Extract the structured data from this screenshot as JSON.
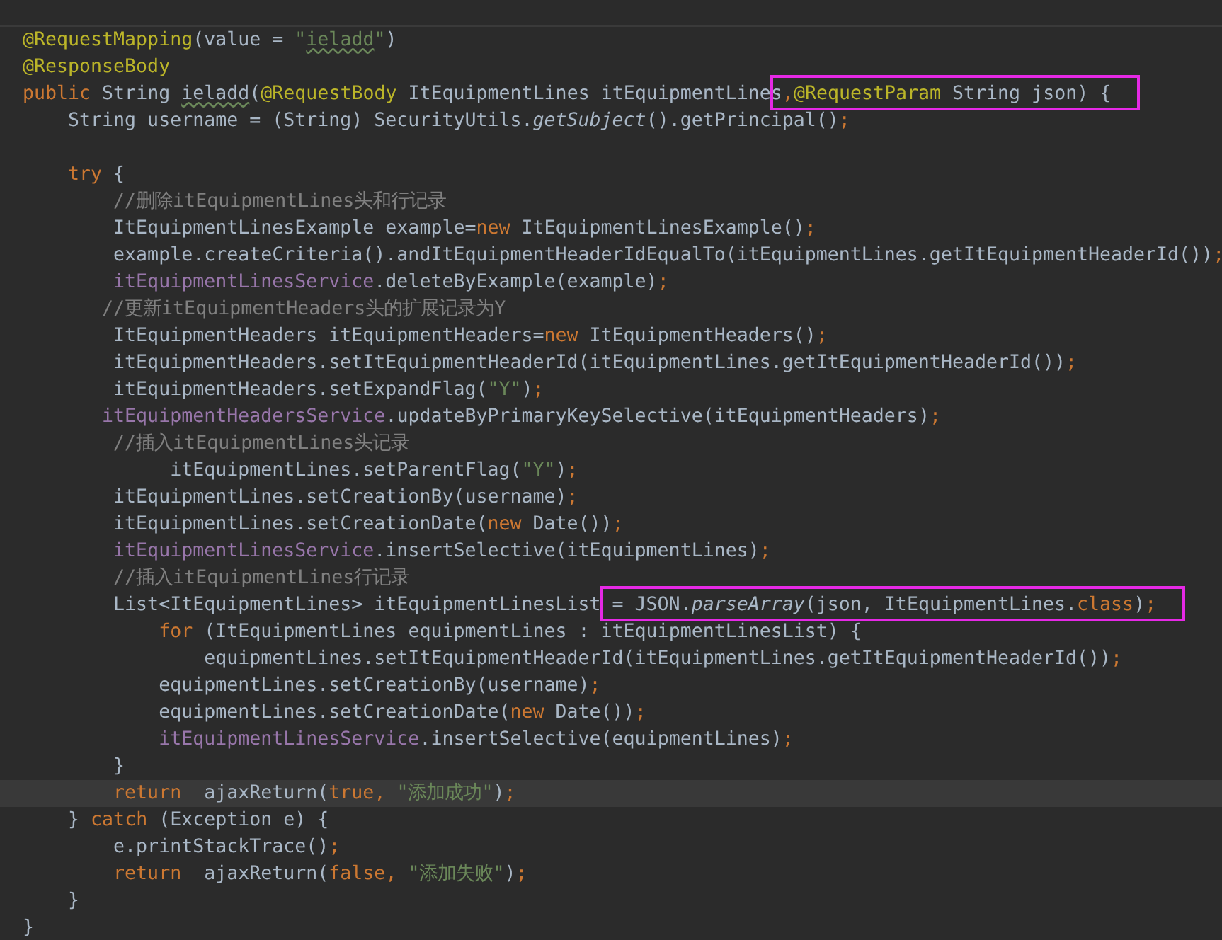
{
  "editor": {
    "lines": [
      {
        "kind": "code",
        "current": false,
        "tokens": [
          {
            "kind": "annotation",
            "text": "@RequestMapping"
          },
          {
            "kind": "plain",
            "text": "(value = "
          },
          {
            "kind": "string",
            "text": "\""
          },
          {
            "kind": "string",
            "text": "ieladd",
            "typo": true
          },
          {
            "kind": "string",
            "text": "\""
          },
          {
            "kind": "plain",
            "text": ")"
          }
        ]
      },
      {
        "kind": "code",
        "current": false,
        "tokens": [
          {
            "kind": "annotation",
            "text": "@ResponseBody"
          }
        ]
      },
      {
        "kind": "code",
        "current": false,
        "tokens": [
          {
            "kind": "keyword",
            "text": "public "
          },
          {
            "kind": "plain",
            "text": "String "
          },
          {
            "kind": "plain",
            "text": "ieladd",
            "typo": true
          },
          {
            "kind": "plain",
            "text": "("
          },
          {
            "kind": "annotation",
            "text": "@RequestBody"
          },
          {
            "kind": "plain",
            "text": " ItEquipmentLines itEquipmentLines"
          }
        ],
        "framed_tokens": [
          {
            "kind": "punct",
            "text": ","
          },
          {
            "kind": "annotation",
            "text": "@RequestParam"
          },
          {
            "kind": "plain",
            "text": " String json) {"
          }
        ]
      },
      {
        "kind": "code",
        "current": false,
        "tokens": [
          {
            "kind": "plain",
            "text": "    String username = (String) SecurityUtils."
          },
          {
            "kind": "italic",
            "text": "getSubject"
          },
          {
            "kind": "plain",
            "text": "().getPrincipal()"
          },
          {
            "kind": "punct",
            "text": ";"
          }
        ]
      },
      {
        "kind": "blank"
      },
      {
        "kind": "code",
        "current": false,
        "tokens": [
          {
            "kind": "keyword",
            "text": "    try "
          },
          {
            "kind": "plain",
            "text": "{"
          }
        ]
      },
      {
        "kind": "code",
        "current": false,
        "tokens": [
          {
            "kind": "comment",
            "text": "        //删除itEquipmentLines头和行记录"
          }
        ]
      },
      {
        "kind": "code",
        "current": false,
        "tokens": [
          {
            "kind": "plain",
            "text": "        ItEquipmentLinesExample example="
          },
          {
            "kind": "keyword",
            "text": "new "
          },
          {
            "kind": "plain",
            "text": "ItEquipmentLinesExample()"
          },
          {
            "kind": "punct",
            "text": ";"
          }
        ]
      },
      {
        "kind": "code",
        "current": false,
        "tokens": [
          {
            "kind": "plain",
            "text": "        example.createCriteria().andItEquipmentHeaderIdEqualTo(itEquipmentLines.getItEquipmentHeaderId())"
          },
          {
            "kind": "punct",
            "text": ";"
          }
        ]
      },
      {
        "kind": "code",
        "current": false,
        "tokens": [
          {
            "kind": "field",
            "text": "        itEquipmentLinesService"
          },
          {
            "kind": "plain",
            "text": ".deleteByExample(example)"
          },
          {
            "kind": "punct",
            "text": ";"
          }
        ]
      },
      {
        "kind": "code",
        "current": false,
        "tokens": [
          {
            "kind": "comment",
            "text": "       //更新itEquipmentHeaders头的扩展记录为Y"
          }
        ]
      },
      {
        "kind": "code",
        "current": false,
        "tokens": [
          {
            "kind": "plain",
            "text": "        ItEquipmentHeaders itEquipmentHeaders="
          },
          {
            "kind": "keyword",
            "text": "new "
          },
          {
            "kind": "plain",
            "text": "ItEquipmentHeaders()"
          },
          {
            "kind": "punct",
            "text": ";"
          }
        ]
      },
      {
        "kind": "code",
        "current": false,
        "tokens": [
          {
            "kind": "plain",
            "text": "        itEquipmentHeaders.setItEquipmentHeaderId(itEquipmentLines.getItEquipmentHeaderId())"
          },
          {
            "kind": "punct",
            "text": ";"
          }
        ]
      },
      {
        "kind": "code",
        "current": false,
        "tokens": [
          {
            "kind": "plain",
            "text": "        itEquipmentHeaders.setExpandFlag("
          },
          {
            "kind": "string",
            "text": "\"Y\""
          },
          {
            "kind": "plain",
            "text": ")"
          },
          {
            "kind": "punct",
            "text": ";"
          }
        ]
      },
      {
        "kind": "code",
        "current": false,
        "tokens": [
          {
            "kind": "field",
            "text": "       itEquipmentHeadersService"
          },
          {
            "kind": "plain",
            "text": ".updateByPrimaryKeySelective(itEquipmentHeaders)"
          },
          {
            "kind": "punct",
            "text": ";"
          }
        ]
      },
      {
        "kind": "code",
        "current": false,
        "tokens": [
          {
            "kind": "comment",
            "text": "        //插入itEquipmentLines头记录"
          }
        ]
      },
      {
        "kind": "code",
        "current": false,
        "tokens": [
          {
            "kind": "plain",
            "text": "             itEquipmentLines.setParentFlag("
          },
          {
            "kind": "string",
            "text": "\"Y\""
          },
          {
            "kind": "plain",
            "text": ")"
          },
          {
            "kind": "punct",
            "text": ";"
          }
        ]
      },
      {
        "kind": "code",
        "current": false,
        "tokens": [
          {
            "kind": "plain",
            "text": "        itEquipmentLines.setCreationBy(username)"
          },
          {
            "kind": "punct",
            "text": ";"
          }
        ]
      },
      {
        "kind": "code",
        "current": false,
        "tokens": [
          {
            "kind": "plain",
            "text": "        itEquipmentLines.setCreationDate("
          },
          {
            "kind": "keyword",
            "text": "new "
          },
          {
            "kind": "plain",
            "text": "Date())"
          },
          {
            "kind": "punct",
            "text": ";"
          }
        ]
      },
      {
        "kind": "code",
        "current": false,
        "tokens": [
          {
            "kind": "field",
            "text": "        itEquipmentLinesService"
          },
          {
            "kind": "plain",
            "text": ".insertSelective(itEquipmentLines)"
          },
          {
            "kind": "punct",
            "text": ";"
          }
        ]
      },
      {
        "kind": "code",
        "current": false,
        "tokens": [
          {
            "kind": "comment",
            "text": "        //插入itEquipmentLines行记录"
          }
        ]
      },
      {
        "kind": "code",
        "current": false,
        "tokens": [
          {
            "kind": "plain",
            "text": "        List<ItEquipmentLines> itEquipmentLinesList "
          }
        ],
        "framed_tokens": [
          {
            "kind": "plain",
            "text": "= JSON."
          },
          {
            "kind": "italic",
            "text": "parseArray"
          },
          {
            "kind": "plain",
            "text": "(json, ItEquipmentLines."
          },
          {
            "kind": "keyword",
            "text": "class"
          },
          {
            "kind": "plain",
            "text": ")"
          },
          {
            "kind": "punct",
            "text": ";"
          }
        ]
      },
      {
        "kind": "code",
        "current": false,
        "tokens": [
          {
            "kind": "keyword",
            "text": "            for "
          },
          {
            "kind": "plain",
            "text": "(ItEquipmentLines equipmentLines : itEquipmentLinesList) {"
          }
        ]
      },
      {
        "kind": "code",
        "current": false,
        "tokens": [
          {
            "kind": "plain",
            "text": "                equipmentLines.setItEquipmentHeaderId(itEquipmentLines.getItEquipmentHeaderId())"
          },
          {
            "kind": "punct",
            "text": ";"
          }
        ]
      },
      {
        "kind": "code",
        "current": false,
        "tokens": [
          {
            "kind": "plain",
            "text": "            equipmentLines.setCreationBy(username)"
          },
          {
            "kind": "punct",
            "text": ";"
          }
        ]
      },
      {
        "kind": "code",
        "current": false,
        "tokens": [
          {
            "kind": "plain",
            "text": "            equipmentLines.setCreationDate("
          },
          {
            "kind": "keyword",
            "text": "new "
          },
          {
            "kind": "plain",
            "text": "Date())"
          },
          {
            "kind": "punct",
            "text": ";"
          }
        ]
      },
      {
        "kind": "code",
        "current": false,
        "tokens": [
          {
            "kind": "field",
            "text": "            itEquipmentLinesService"
          },
          {
            "kind": "plain",
            "text": ".insertSelective(equipmentLines)"
          },
          {
            "kind": "punct",
            "text": ";"
          }
        ]
      },
      {
        "kind": "code",
        "current": false,
        "tokens": [
          {
            "kind": "plain",
            "text": "        }"
          }
        ]
      },
      {
        "kind": "code",
        "current": true,
        "tokens": [
          {
            "kind": "keyword",
            "text": "        return  "
          },
          {
            "kind": "plain",
            "text": "ajaxReturn("
          },
          {
            "kind": "keyword",
            "text": "true"
          },
          {
            "kind": "punct",
            "text": ", "
          },
          {
            "kind": "string",
            "text": "\"添加成功\""
          },
          {
            "kind": "plain",
            "text": ")"
          },
          {
            "kind": "punct",
            "text": ";"
          }
        ]
      },
      {
        "kind": "code",
        "current": false,
        "tokens": [
          {
            "kind": "plain",
            "text": "    } "
          },
          {
            "kind": "keyword",
            "text": "catch "
          },
          {
            "kind": "plain",
            "text": "(Exception e) {"
          }
        ]
      },
      {
        "kind": "code",
        "current": false,
        "tokens": [
          {
            "kind": "plain",
            "text": "        e.printStackTrace()"
          },
          {
            "kind": "punct",
            "text": ";"
          }
        ]
      },
      {
        "kind": "code",
        "current": false,
        "tokens": [
          {
            "kind": "keyword",
            "text": "        return  "
          },
          {
            "kind": "plain",
            "text": "ajaxReturn("
          },
          {
            "kind": "keyword",
            "text": "false"
          },
          {
            "kind": "punct",
            "text": ", "
          },
          {
            "kind": "string",
            "text": "\"添加失败\""
          },
          {
            "kind": "plain",
            "text": ")"
          },
          {
            "kind": "punct",
            "text": ";"
          }
        ]
      },
      {
        "kind": "code",
        "current": false,
        "tokens": [
          {
            "kind": "plain",
            "text": "    }"
          }
        ]
      },
      {
        "kind": "code",
        "current": false,
        "tokens": [
          {
            "kind": "plain",
            "text": "}"
          }
        ]
      }
    ]
  }
}
